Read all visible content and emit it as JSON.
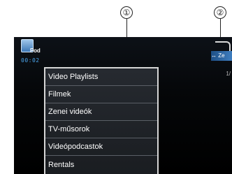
{
  "callouts": [
    {
      "number": "①"
    },
    {
      "number": "②"
    }
  ],
  "status": {
    "source_label": "Pod",
    "time": "00:02",
    "page_indicator": "1/"
  },
  "top_right": {
    "label": "↔ Ze"
  },
  "menu": {
    "items": [
      {
        "label": "Video Playlists"
      },
      {
        "label": "Filmek"
      },
      {
        "label": "Zenei videók"
      },
      {
        "label": "TV-műsorok"
      },
      {
        "label": "Videópodcastok"
      },
      {
        "label": "Rentals"
      }
    ]
  }
}
